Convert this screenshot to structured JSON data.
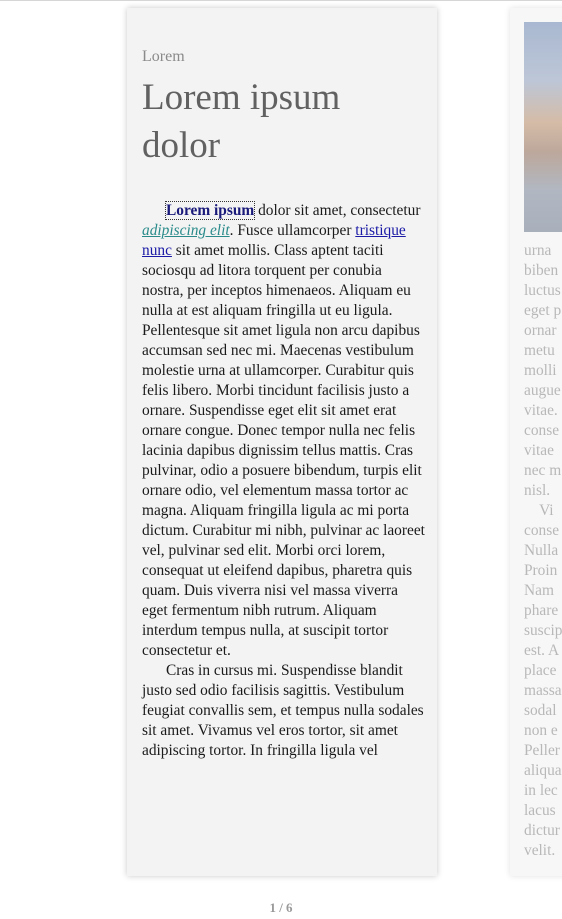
{
  "page": {
    "kicker": "Lorem",
    "title": "Lorem ipsum dolor",
    "para1": {
      "strong_link": "Lorem ipsum",
      "text_a": " dolor sit amet, consectetur ",
      "em_link": "adipiscing elit",
      "text_b": ". Fusce ullamcorper ",
      "plain_link": "tristique nunc",
      "text_c": " sit amet mollis. Class aptent taciti sociosqu ad litora torquent per conubia nostra, per inceptos himenaeos. Aliquam eu nulla at est aliquam fringilla ut eu ligula. Pellentesque sit amet ligula non arcu dapibus accumsan sed nec mi. Maecenas vestibulum molestie urna at ullamcorper. Curabitur quis felis libero. Morbi tincidunt facilisis justo a ornare. Suspendisse eget elit sit amet erat ornare congue. Donec tempor nulla nec felis lacinia dapibus dignissim tellus mattis. Cras pulvinar, odio a posuere bibendum, turpis elit ornare odio, vel elementum massa tortor ac magna. Aliquam fringilla ligula ac mi porta dictum. Curabitur mi nibh, pulvinar ac laoreet vel, pulvinar sed elit. Morbi orci lorem, consequat ut eleifend dapibus, pharetra quis quam. Duis viverra nisi vel massa viverra eget fermentum nibh rutrum. Aliquam interdum tempus nulla, at suscipit tortor consectetur et."
    },
    "para2": "Cras in cursus mi. Suspendisse blandit justo sed odio facilisis sagittis. Vestibulum feugiat convallis sem, et tempus nulla sodales sit amet. Vivamus vel eros tortor, sit amet adipiscing tortor. In fringilla ligula vel"
  },
  "next_page": {
    "text": "urna\nbiben\nluctus\neget p\nornar\nmetu\nmolli\naugue\nvitae.\nconse\nvitae\nnec m\nnisl.\n    Vi\nconse\nNulla\nProin\nNam\nphare\nsuscip\nest. A\nplace\nmassa\nsodal\nnon e\nPeller\naliqua\nin lec\nlacus\ndictur\nvelit."
  },
  "pagination": {
    "label": "1 / 6"
  }
}
